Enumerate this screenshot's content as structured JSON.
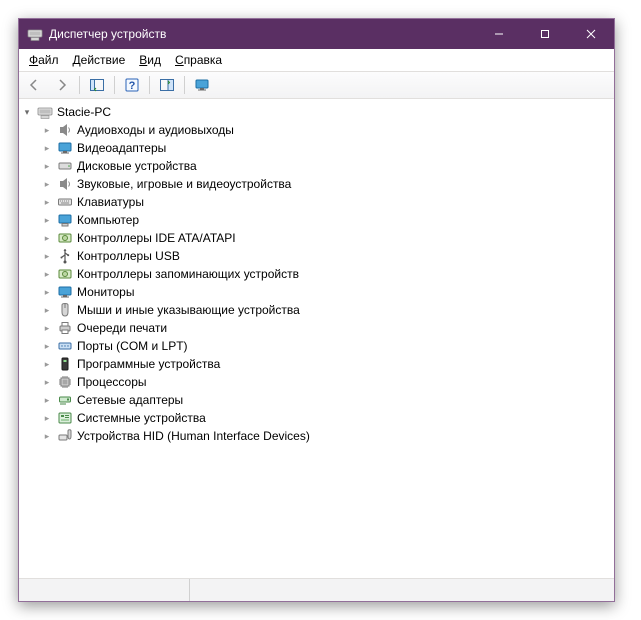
{
  "titlebar": {
    "title": "Диспетчер устройств"
  },
  "menubar": {
    "file": {
      "ul": "Ф",
      "rest": "айл"
    },
    "action": {
      "ul": "Д",
      "rest": "ействие"
    },
    "view": {
      "ul": "В",
      "rest": "ид"
    },
    "help": {
      "ul": "С",
      "rest": "правка"
    }
  },
  "tree": {
    "root": {
      "label": "Stacie-PC",
      "expanded": true,
      "children": [
        {
          "label": "Аудиовходы и аудиовыходы",
          "icon": "audio-io"
        },
        {
          "label": "Видеоадаптеры",
          "icon": "display-adapter"
        },
        {
          "label": "Дисковые устройства",
          "icon": "disk"
        },
        {
          "label": "Звуковые, игровые и видеоустройства",
          "icon": "sound"
        },
        {
          "label": "Клавиатуры",
          "icon": "keyboard"
        },
        {
          "label": "Компьютер",
          "icon": "computer"
        },
        {
          "label": "Контроллеры IDE ATA/ATAPI",
          "icon": "ide"
        },
        {
          "label": "Контроллеры USB",
          "icon": "usb"
        },
        {
          "label": "Контроллеры запоминающих устройств",
          "icon": "storage"
        },
        {
          "label": "Мониторы",
          "icon": "monitor"
        },
        {
          "label": "Мыши и иные указывающие устройства",
          "icon": "mouse"
        },
        {
          "label": "Очереди печати",
          "icon": "printer"
        },
        {
          "label": "Порты (COM и LPT)",
          "icon": "port"
        },
        {
          "label": "Программные устройства",
          "icon": "software"
        },
        {
          "label": "Процессоры",
          "icon": "cpu"
        },
        {
          "label": "Сетевые адаптеры",
          "icon": "network"
        },
        {
          "label": "Системные устройства",
          "icon": "system"
        },
        {
          "label": "Устройства HID (Human Interface Devices)",
          "icon": "hid"
        }
      ]
    }
  }
}
